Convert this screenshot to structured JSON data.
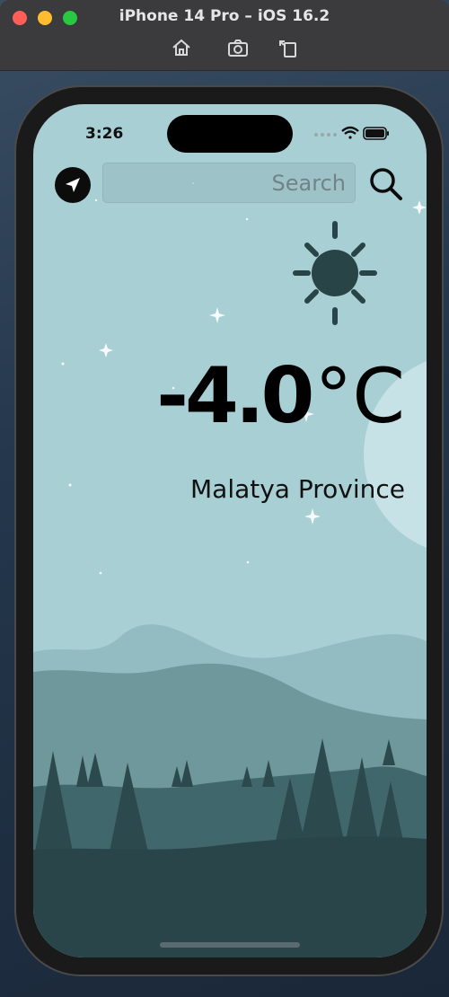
{
  "window": {
    "title": "iPhone 14 Pro – iOS 16.2",
    "toolbar_icons": [
      "home-icon",
      "screenshot-icon",
      "rotate-icon"
    ]
  },
  "status_bar": {
    "time": "3:26",
    "icons": [
      "signal-icon",
      "wifi-icon",
      "battery-icon"
    ]
  },
  "app": {
    "search": {
      "placeholder": "Search",
      "value": ""
    },
    "location_button_icon": "location-arrow-icon",
    "search_button_icon": "magnifier-icon",
    "weather_icon": "sun-icon",
    "temperature": "-4.0",
    "unit": "°C",
    "city": "Malatya Province"
  },
  "colors": {
    "sky": "#a7cfd4",
    "mountain_far": "#92bcc1",
    "mountain_mid": "#6f989c",
    "forest": "#40676b",
    "ground": "#2a4549"
  }
}
